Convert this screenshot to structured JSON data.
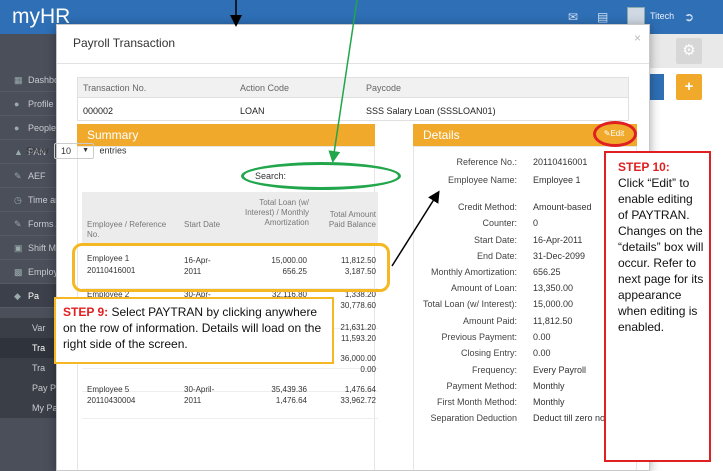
{
  "app": {
    "brand": "myHR",
    "user_name": "Titech"
  },
  "sidebar": {
    "items": [
      {
        "label": "Dashbo",
        "icon": "dashboard-icon"
      },
      {
        "label": "Profile",
        "icon": "user-icon"
      },
      {
        "label": "People",
        "icon": "people-icon"
      },
      {
        "label": "PAN",
        "icon": "trophy-icon"
      },
      {
        "label": "AEF",
        "icon": "pencil-icon"
      },
      {
        "label": "Time an",
        "icon": "clock-icon"
      },
      {
        "label": "Forms A",
        "icon": "forms-icon"
      },
      {
        "label": "Shift Ma",
        "icon": "calendar-icon"
      },
      {
        "label": "Employ",
        "icon": "chart-icon"
      },
      {
        "label": "Pa",
        "icon": "payroll-icon"
      }
    ],
    "sub_items": [
      "Var",
      "Tra",
      "Tra",
      "Pay P",
      "My Pay"
    ]
  },
  "modal": {
    "title": "Payroll Transaction",
    "close": "×",
    "transaction": {
      "headers": [
        "Transaction No.",
        "Action Code",
        "Paycode"
      ],
      "values": [
        "000002",
        "LOAN",
        "SSS Salary Loan (SSSLOAN01)"
      ]
    },
    "summary": {
      "title": "Summary",
      "show_label": "Show",
      "entries_value": "10",
      "entries_label": "entries",
      "search_label": "Search:",
      "columns": [
        "Employee / Reference No.",
        "Start Date",
        "Total Loan (w/ Interest) / Monthly Amortization",
        "Total Amount Paid Balance"
      ],
      "rows": [
        {
          "name": "Employee 1",
          "ref": "20110416001",
          "start": "16-Apr-2011",
          "loan": "15,000.00",
          "amort": "656.25",
          "paid": "11,812.50",
          "balance": "3,187.50"
        },
        {
          "name": "Employee 2",
          "ref": "",
          "start": "30-Apr-",
          "loan": "32,116.80",
          "amort": "",
          "paid": "1,338.20",
          "balance": "30,778.60"
        },
        {
          "name": "",
          "ref": "",
          "start": "",
          "loan": "",
          "amort": "",
          "paid": "21,631.20",
          "balance": "11,593.20"
        },
        {
          "name": "",
          "ref": "",
          "start": "",
          "loan": "",
          "amort": "",
          "paid": "36,000.00",
          "balance": "0.00"
        },
        {
          "name": "Employee 5",
          "ref": "20110430004",
          "start": "30-April-2011",
          "loan": "35,439.36",
          "amort": "1,476.64",
          "paid": "1,476.64",
          "balance": "33,962.72"
        }
      ]
    },
    "details": {
      "title": "Details",
      "edit_label": "Edit",
      "fields": [
        {
          "label": "Reference No.:",
          "value": "20110416001"
        },
        {
          "label": "Employee Name:",
          "value": "Employee 1"
        },
        {
          "label": "Credit Method:",
          "value": "Amount-based"
        },
        {
          "label": "Counter:",
          "value": "0"
        },
        {
          "label": "Start Date:",
          "value": "16-Apr-2011"
        },
        {
          "label": "End Date:",
          "value": "31-Dec-2099"
        },
        {
          "label": "Monthly Amortization:",
          "value": "656.25"
        },
        {
          "label": "Amount of Loan:",
          "value": "13,350.00"
        },
        {
          "label": "Total Loan (w/ Interest):",
          "value": "15,000.00"
        },
        {
          "label": "Amount Paid:",
          "value": "11,812.50"
        },
        {
          "label": "Previous Payment:",
          "value": "0.00"
        },
        {
          "label": "Closing Entry:",
          "value": "0.00"
        },
        {
          "label": "Frequency:",
          "value": "Every Payroll"
        },
        {
          "label": "Payment Method:",
          "value": "Monthly"
        },
        {
          "label": "First Month Method:",
          "value": "Monthly"
        },
        {
          "label": "Separation Deduction",
          "value": "Deduct till zero no"
        }
      ]
    }
  },
  "annotations": {
    "step9": {
      "step": "STEP 9:",
      "text": " Select PAYTRAN by clicking anywhere on the row of information. Details will load on the right side of the screen."
    },
    "step10": {
      "step": "STEP 10:",
      "text": "Click “Edit” to enable editing of PAYTRAN. Changes on the “details” box will occur. Refer to next page for its appearance when editing is enabled."
    },
    "colors": {
      "highlight_yellow": "#f5b823",
      "alert_red": "#e02020",
      "arrow_green": "#21a64b"
    }
  },
  "colors": {
    "brand_blue": "#2e6fb5",
    "panel_orange": "#f0a92b",
    "sidebar_dark": "#4a4f5a"
  }
}
